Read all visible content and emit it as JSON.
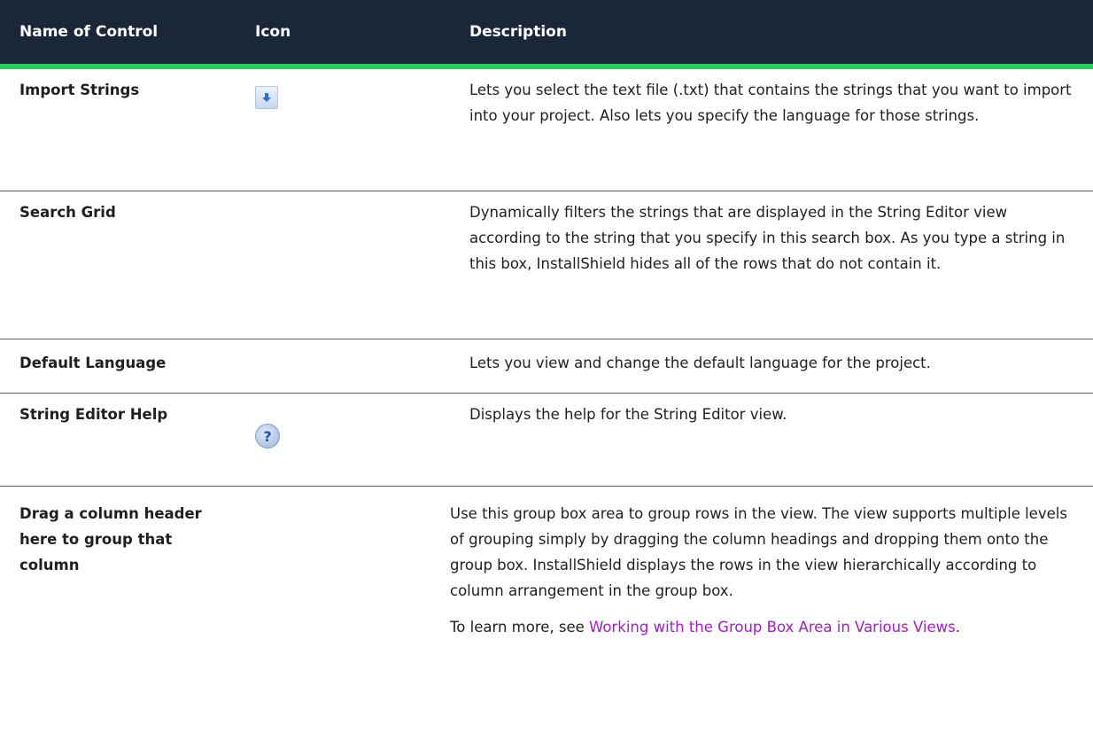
{
  "header": {
    "col_name": "Name of Control",
    "col_icon": "Icon",
    "col_desc": "Description"
  },
  "rows": [
    {
      "name": "Import Strings",
      "icon": "import-arrow-icon",
      "description": "Lets you select the text file (.txt) that contains the strings that you want to import into your project. Also lets you specify the language for those strings."
    },
    {
      "name": "Search Grid",
      "icon": "",
      "description": "Dynamically filters the strings that are displayed in the String Editor view according to the string that you specify in this search box. As you type a string in this box, InstallShield hides all of the rows that do not contain it."
    },
    {
      "name": "Default Language",
      "icon": "",
      "description": "Lets you view and change the default language for the project."
    },
    {
      "name": "String Editor Help",
      "icon": "help-icon",
      "icon_glyph": "?",
      "description": "Displays the help for the String Editor view."
    },
    {
      "name": "Drag a column header here to group that column",
      "icon": "",
      "description": "Use this group box area to group rows in the view. The view supports multiple levels of grouping simply by dragging the column headings and dropping them onto the group box. InstallShield displays the rows in the view hierarchically according to column arrangement in the group box.",
      "see_also_prefix": "To learn more, see ",
      "see_also_link": "Working with the Group Box Area in Various Views",
      "see_also_suffix": "."
    }
  ],
  "colors": {
    "header_bg": "#1c2639",
    "header_rule": "#29cc5a",
    "link": "#a020c0"
  }
}
